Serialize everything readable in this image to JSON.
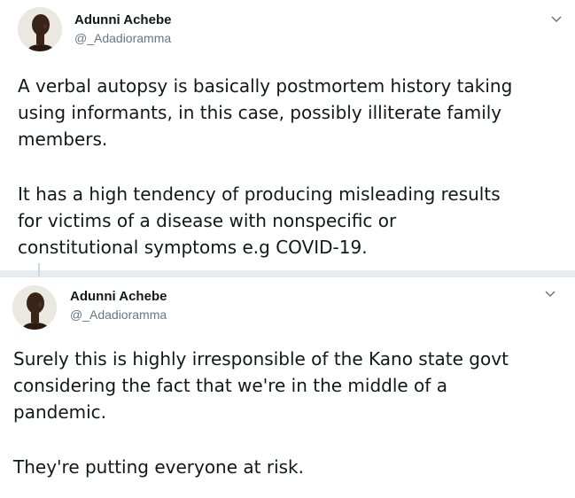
{
  "tweets": [
    {
      "author": {
        "name": "Adunni Achebe",
        "handle": "@_Adadioramma"
      },
      "caret_icon": "chevron-down-icon",
      "paragraphs": [
        [
          "A verbal autopsy is basically postmortem history taking",
          "using informants, in this case, possibly illiterate family",
          "members."
        ],
        [
          "It has a high tendency of producing misleading results",
          "for victims of a disease with nonspecific or",
          "constitutional symptoms e.g COVID-19."
        ]
      ]
    },
    {
      "author": {
        "name": "Adunni Achebe",
        "handle": "@_Adadioramma"
      },
      "caret_icon": "chevron-down-icon",
      "paragraphs": [
        [
          "Surely this is highly irresponsible of the Kano state govt",
          "considering the fact that we're in the middle of a",
          "pandemic."
        ],
        [
          "They're putting everyone at risk."
        ]
      ]
    }
  ],
  "colors": {
    "background": "#e6ecf0",
    "card": "#ffffff",
    "text": "#14171a",
    "secondary": "#657786",
    "divider": "#e1e8ed"
  }
}
